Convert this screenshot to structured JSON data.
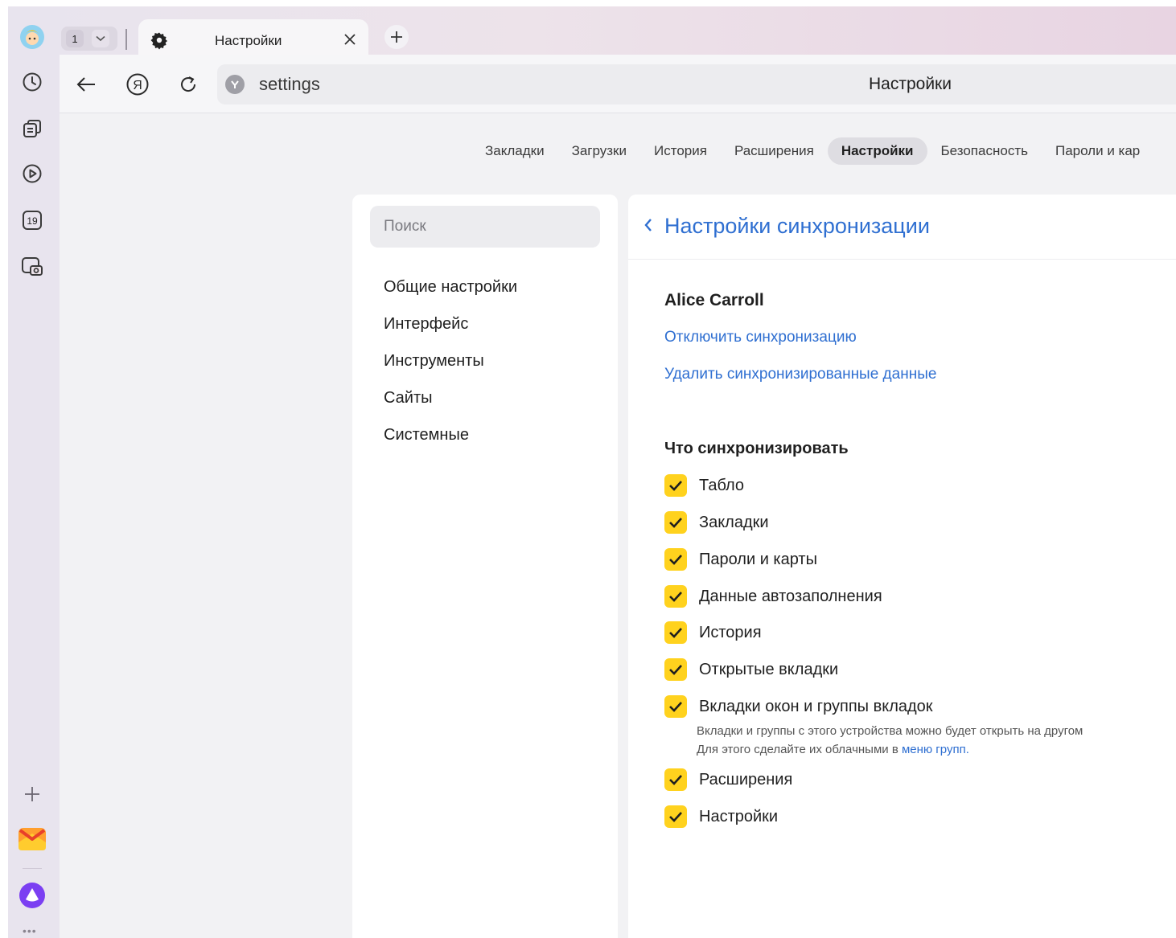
{
  "tabbar": {
    "tab_count": "1",
    "active_tab_title": "Настройки"
  },
  "toolbar": {
    "url": "settings",
    "page_title": "Настройки"
  },
  "topnav": {
    "items": [
      "Закладки",
      "Загрузки",
      "История",
      "Расширения",
      "Настройки",
      "Безопасность",
      "Пароли и кар"
    ],
    "active": "Настройки"
  },
  "sidebar": {
    "rail_calendar_day": "19",
    "search_placeholder": "Поиск",
    "menu": [
      "Общие настройки",
      "Интерфейс",
      "Инструменты",
      "Сайты",
      "Системные"
    ]
  },
  "sync": {
    "title": "Настройки синхронизации",
    "account_name": "Alice Carroll",
    "disable_link": "Отключить синхронизацию",
    "delete_link": "Удалить синхронизированные данные",
    "section_title": "Что синхронизировать",
    "items": [
      {
        "label": "Табло",
        "checked": true
      },
      {
        "label": "Закладки",
        "checked": true
      },
      {
        "label": "Пароли и карты",
        "checked": true
      },
      {
        "label": "Данные автозаполнения",
        "checked": true
      },
      {
        "label": "История",
        "checked": true
      },
      {
        "label": "Открытые вкладки",
        "checked": true
      },
      {
        "label": "Вкладки окон и группы вкладок",
        "checked": true
      },
      {
        "label": "Расширения",
        "checked": true
      },
      {
        "label": "Настройки",
        "checked": true
      }
    ],
    "note_line1": "Вкладки и группы с этого устройства можно будет открыть на другом",
    "note_line2_prefix": "Для этого сделайте их облачными в ",
    "note_link": "меню групп",
    "note_suffix": "."
  },
  "colors": {
    "accent_link": "#2f6fd1",
    "checkbox": "#ffd21e",
    "alice_purple": "#7b3ff2"
  }
}
